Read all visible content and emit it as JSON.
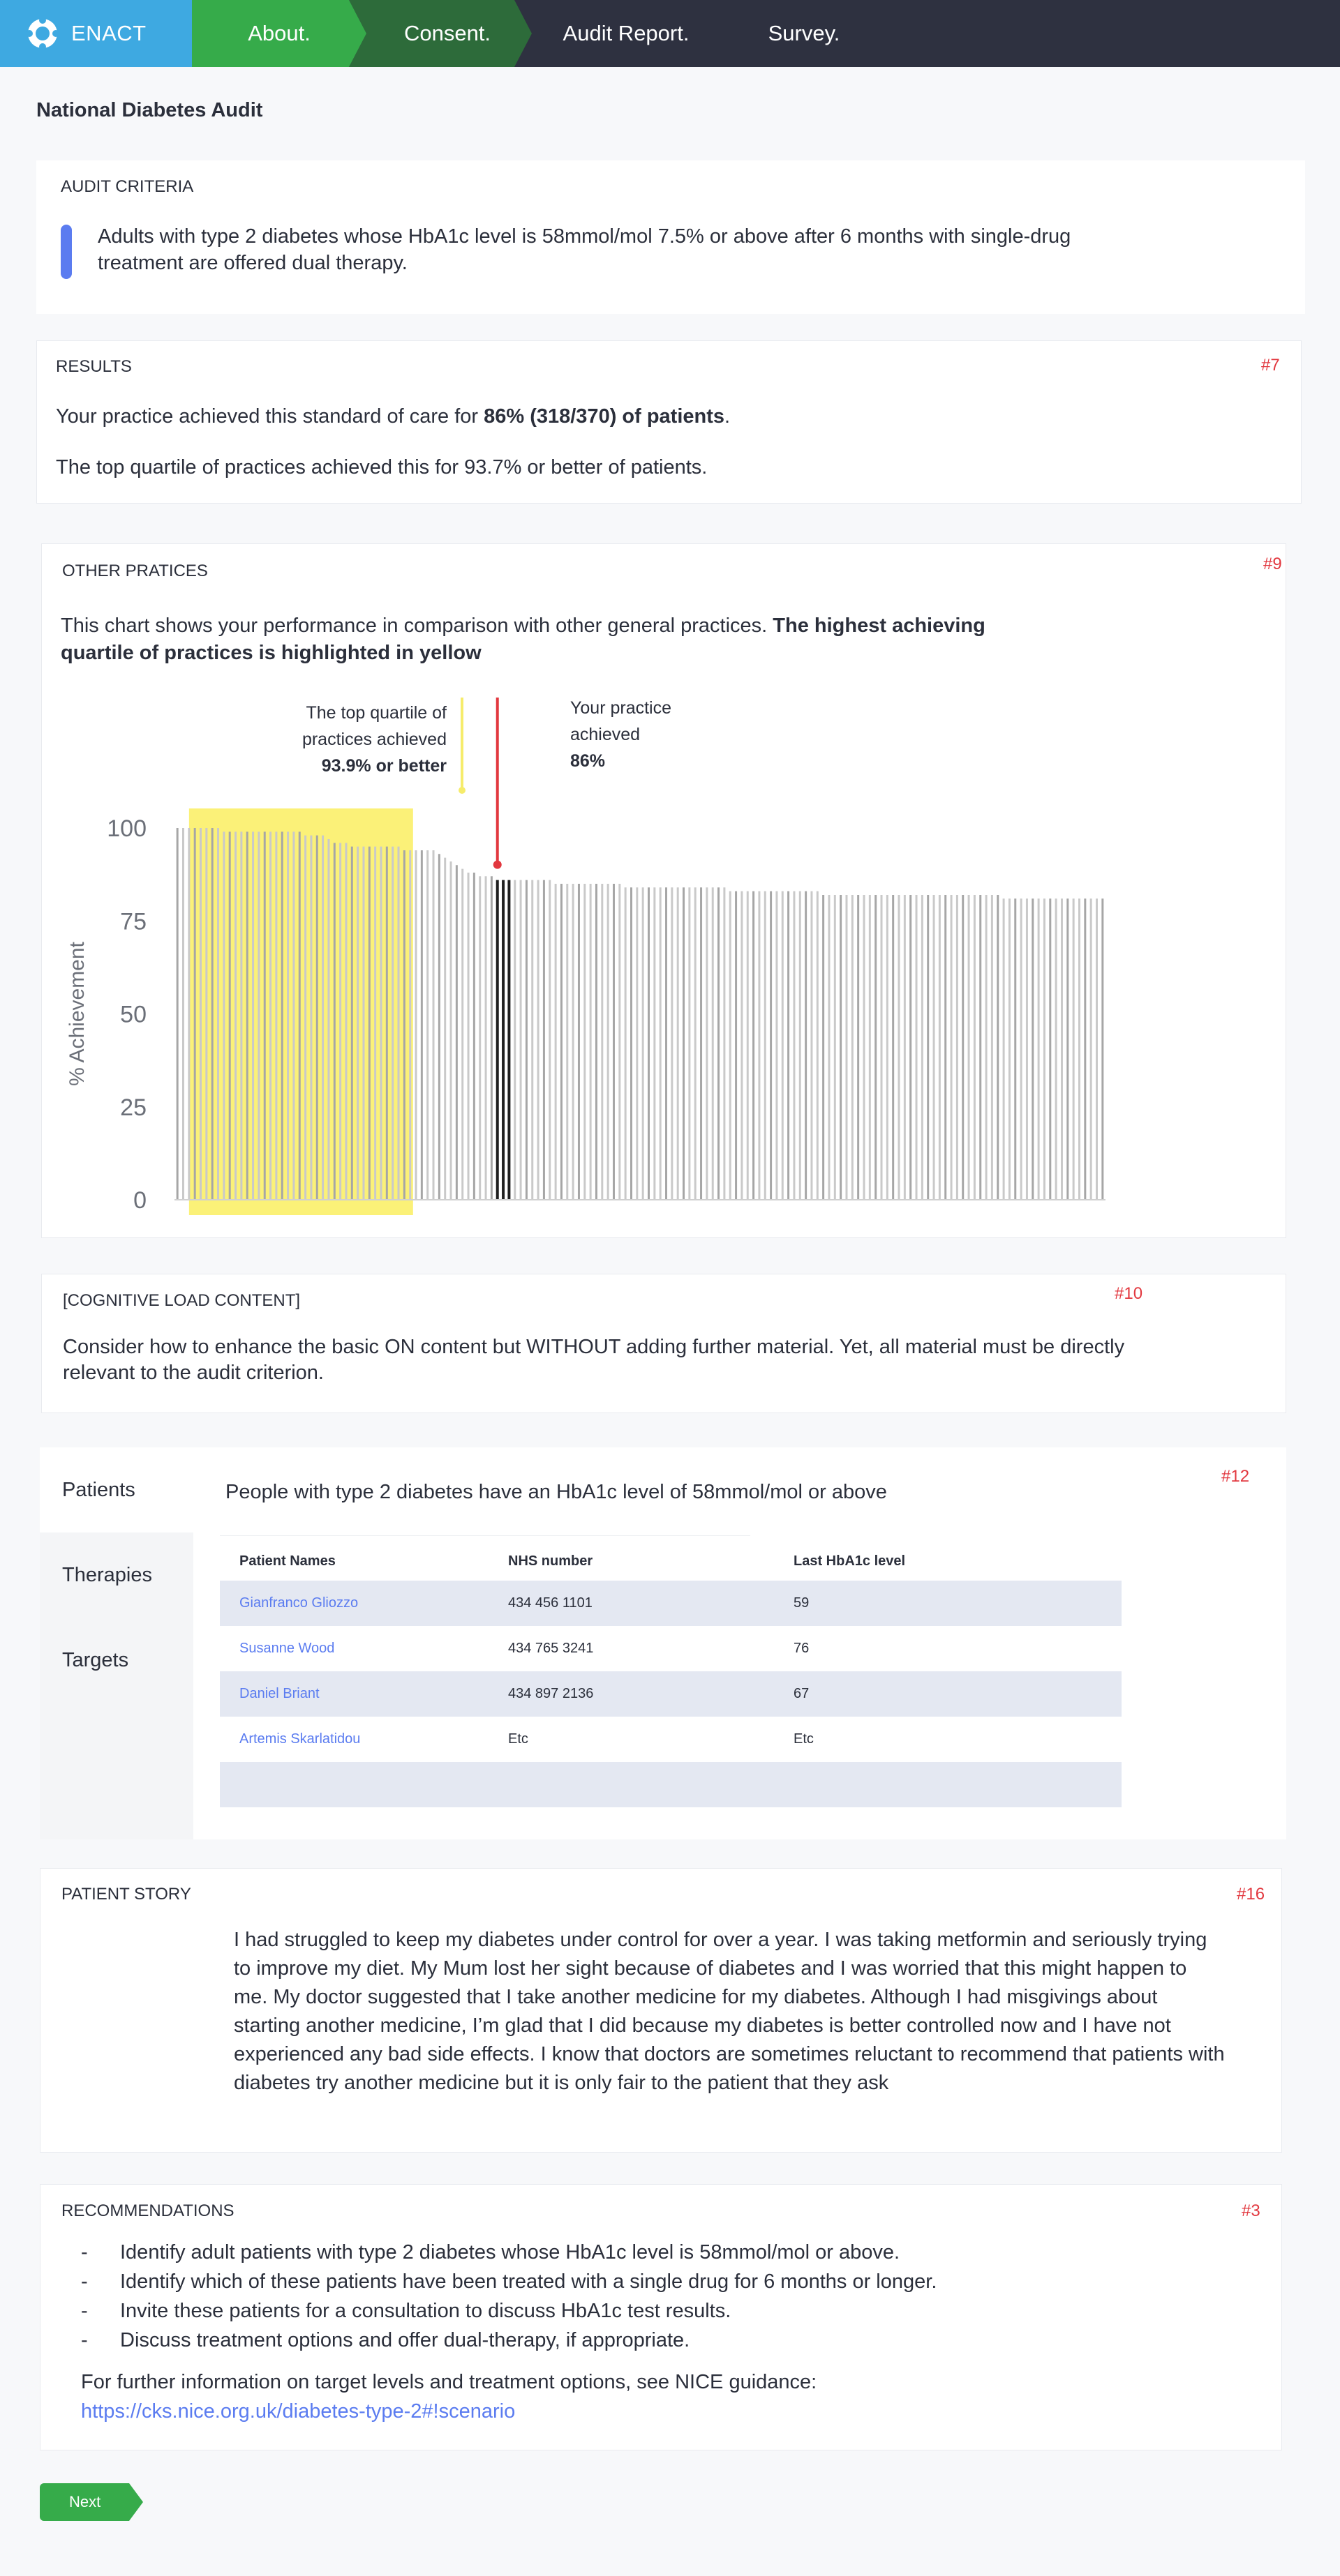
{
  "nav": {
    "brand": "ENACT",
    "steps": [
      "About.",
      "Consent.",
      "Audit Report.",
      "Survey."
    ]
  },
  "page_title": "National Diabetes Audit",
  "audit_criteria": {
    "heading": "AUDIT CRITERIA",
    "text": "Adults with type 2 diabetes whose HbA1c level is 58mmol/mol 7.5% or above after 6 months with single-drug treatment are offered dual therapy."
  },
  "results": {
    "heading": "RESULTS",
    "ref": "#7",
    "line1_prefix": "Your practice achieved this standard of care for ",
    "line1_bold": "86% (318/370) of patients",
    "line1_suffix": ".",
    "line2": "The top quartile of practices achieved this for 93.7% or better of patients."
  },
  "other_practices": {
    "heading": "OTHER PRATICES",
    "ref": "#9",
    "intro_plain": "This chart shows your performance in comparison with other general practices. ",
    "intro_bold": "The highest achieving quartile of practices is highlighted in yellow",
    "top_quartile_annotation": [
      "The top quartile of",
      "practices achieved",
      "93.9% or better"
    ],
    "your_practice_annotation": [
      "Your practice",
      "achieved",
      "86%"
    ]
  },
  "chart_data": {
    "type": "bar",
    "ylabel": "% Achievement",
    "ylim": [
      0,
      100
    ],
    "yticks": [
      0,
      25,
      50,
      75,
      100
    ],
    "highlight_top_quartile": true,
    "your_practice_value": 86,
    "top_quartile_threshold": 93.9,
    "values": [
      100,
      100,
      100,
      100,
      100,
      100,
      100,
      100,
      99,
      99,
      99,
      99,
      99,
      99,
      99,
      99,
      99,
      99,
      99,
      99,
      99,
      99,
      98,
      98,
      98,
      98,
      97,
      96,
      96,
      96,
      95,
      95,
      95,
      95,
      95,
      95,
      95,
      95,
      95,
      94,
      94,
      94,
      94,
      94,
      94,
      93,
      92,
      91,
      90,
      89,
      88,
      88,
      87,
      87,
      87,
      86,
      86,
      86,
      86,
      86,
      86,
      86,
      86,
      86,
      86,
      85,
      85,
      85,
      85,
      85,
      85,
      85,
      85,
      85,
      85,
      85,
      85,
      84,
      84,
      84,
      84,
      84,
      84,
      84,
      84,
      84,
      84,
      84,
      84,
      84,
      84,
      84,
      84,
      84,
      84,
      83,
      83,
      83,
      83,
      83,
      83,
      83,
      83,
      83,
      83,
      83,
      83,
      83,
      83,
      83,
      83,
      82,
      82,
      82,
      82,
      82,
      82,
      82,
      82,
      82,
      82,
      82,
      82,
      82,
      82,
      82,
      82,
      82,
      82,
      82,
      82,
      82,
      82,
      82,
      82,
      82,
      82,
      82,
      82,
      82,
      82,
      82,
      81,
      81,
      81,
      81,
      81,
      81,
      81,
      81,
      81,
      81,
      81,
      81,
      81,
      81,
      81,
      81,
      81,
      81
    ]
  },
  "cognitive_load": {
    "heading": "[COGNITIVE LOAD CONTENT]",
    "ref": "#10",
    "text": "Consider how to enhance the basic ON content but WITHOUT adding further material.  Yet, all material must be directly relevant to the audit criterion."
  },
  "patients": {
    "tabs": [
      "Patients",
      "Therapies",
      "Targets"
    ],
    "ref": "#12",
    "title": "People with type 2 diabetes have an HbA1c level of 58mmol/mol or above",
    "columns": [
      "Patient Names",
      "NHS number",
      "Last HbA1c level"
    ],
    "rows": [
      {
        "name": "Gianfranco Gliozzo",
        "nhs": "434 456 1101",
        "level": "59"
      },
      {
        "name": "Susanne Wood",
        "nhs": "434 765 3241",
        "level": "76"
      },
      {
        "name": "Daniel Briant",
        "nhs": "434 897 2136",
        "level": "67"
      },
      {
        "name": "Artemis Skarlatidou",
        "nhs": "Etc",
        "level": "Etc"
      }
    ]
  },
  "patient_story": {
    "heading": "PATIENT STORY",
    "ref": "#16",
    "text": "I had struggled to keep my diabetes under control for over a year.  I was taking metformin and seriously trying to improve my diet.  My Mum lost her sight because of diabetes and I was worried that this might happen to me.  My doctor suggested that I take another medicine for my diabetes.  Although I had misgivings about starting another medicine, I’m glad that I did because my diabetes is better controlled now and I have not experienced any bad side effects.  I know that doctors are sometimes reluctant to recommend that patients with diabetes try another medicine but it is only fair to the patient that they ask"
  },
  "recommendations": {
    "heading": "RECOMMENDATIONS",
    "ref": "#3",
    "items": [
      "Identify adult patients with type 2 diabetes whose HbA1c level is 58mmol/mol or above.",
      "Identify which of these patients have been treated with a single drug for 6 months or longer.",
      "Invite these patients for a consultation to discuss HbA1c test results.",
      "Discuss treatment options and offer dual-therapy, if appropriate."
    ],
    "info": "For further information on target levels and treatment options, see NICE guidance:",
    "link": "https://cks.nice.org.uk/diabetes-type-2#!scenario"
  },
  "next_button": "Next"
}
